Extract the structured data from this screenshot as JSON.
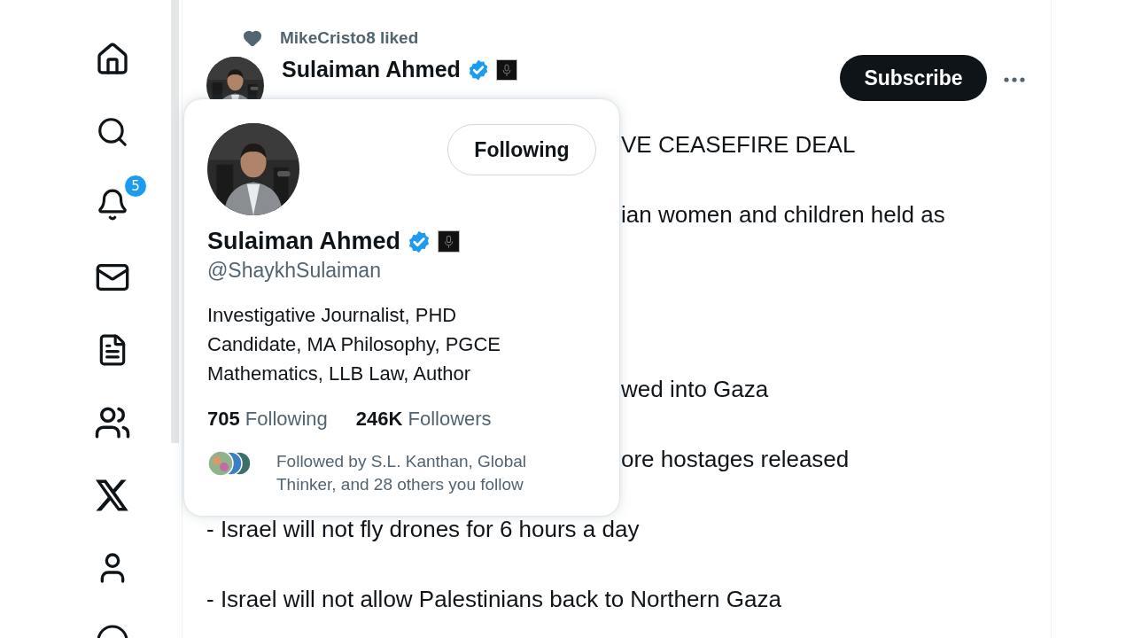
{
  "sidebar": {
    "notification_badge": "5"
  },
  "tweet": {
    "social_context": "MikeCristo8 liked",
    "author": {
      "name": "Sulaiman Ahmed"
    },
    "subscribe_button": "Subscribe",
    "lines": [
      {
        "kind": "clipped",
        "text": "VE CEASEFIRE DEAL"
      },
      {
        "kind": "clipped",
        "text": "ian women and children held as"
      },
      {
        "kind": "clipped",
        "text": "wed into Gaza"
      },
      {
        "kind": "clipped",
        "text": "ore hostages released"
      },
      {
        "kind": "full",
        "text": "- Israel will not fly drones for 6 hours a day"
      },
      {
        "kind": "full",
        "text": "- Israel will not allow Palestinians back to Northern Gaza"
      }
    ]
  },
  "hover_card": {
    "follow_button": "Following",
    "name": "Sulaiman Ahmed",
    "handle": "@ShaykhSulaiman",
    "bio": "Investigative Journalist, PHD Candidate, MA Philosophy, PGCE Mathematics, LLB Law, Author",
    "stats": [
      "**705** Following",
      "**246K** Followers"
    ],
    "followed_by": "Followed by S.L. Kanthan, Global Thinker, and 28 others you follow"
  }
}
